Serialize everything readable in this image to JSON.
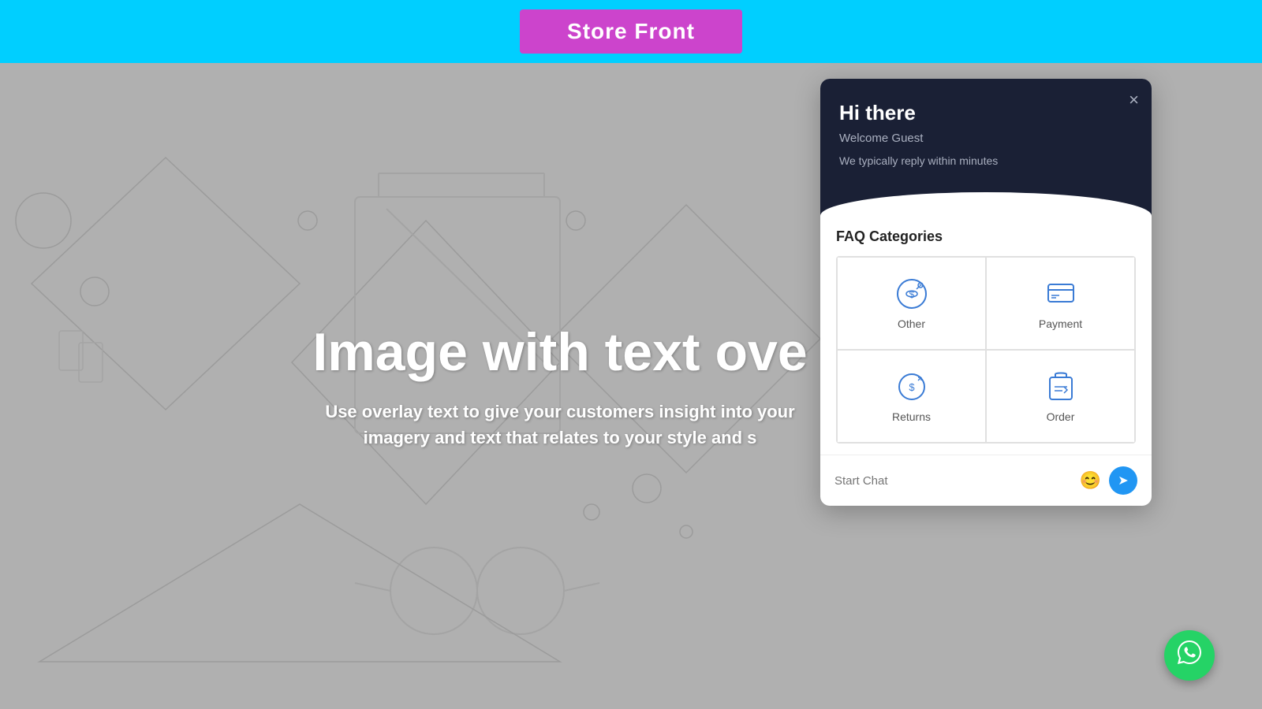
{
  "header": {
    "bg_color": "#00cfff",
    "title_box_color": "#cc44cc",
    "title": "Store Front"
  },
  "hero": {
    "title": "Image with text ove",
    "subtitle": "Use overlay text to give your customers insight into your\nimagery and text that relates to your style and s"
  },
  "chat": {
    "close_label": "×",
    "greeting": "Hi there",
    "guest_label": "Welcome Guest",
    "reply_time": "We typically reply within minutes",
    "faq_section_title": "FAQ Categories",
    "faq_items": [
      {
        "id": "other",
        "label": "Other"
      },
      {
        "id": "payment",
        "label": "Payment"
      },
      {
        "id": "returns",
        "label": "Returns"
      },
      {
        "id": "order",
        "label": "Order"
      }
    ],
    "input_placeholder": "Start Chat",
    "emoji_icon": "😊",
    "send_icon": "➤"
  },
  "whatsapp": {
    "aria_label": "WhatsApp Chat"
  }
}
